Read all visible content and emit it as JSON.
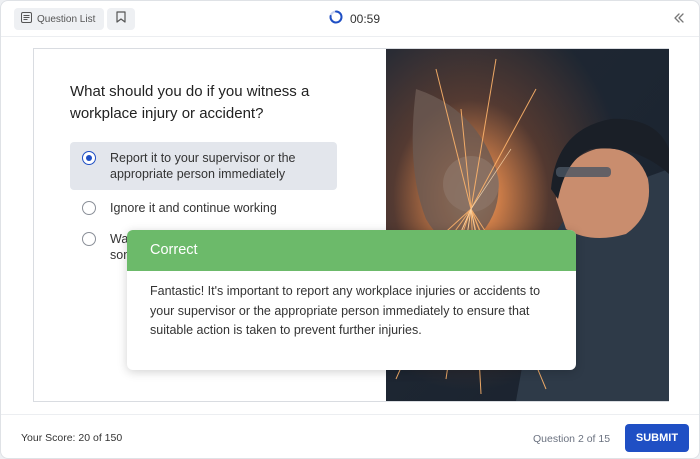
{
  "header": {
    "question_list_label": "Question List",
    "question_list_icon": "list-icon",
    "bookmark_icon": "bookmark-icon",
    "timer_icon": "timer-ring-icon",
    "timer": "00:59",
    "collapse_icon": "double-chevron-left-icon"
  },
  "question": {
    "text": "What should you do if you witness a workplace injury or accident?",
    "options": [
      {
        "label": "Report it to your supervisor or the appropriate person immediately",
        "selected": true
      },
      {
        "label": "Ignore it and continue working",
        "selected": false
      },
      {
        "label": "Wait for someone else to",
        "selected": false
      }
    ],
    "image_alt": "worker grinding metal with sparks"
  },
  "feedback": {
    "status": "Correct",
    "message": "Fantastic! It's important to report any workplace injuries or accidents to your supervisor or the appropriate person immediately to ensure that suitable action is taken to prevent further injuries."
  },
  "footer": {
    "score": "Your Score: 20 of 150",
    "progress": "Question 2 of 15",
    "submit_label": "SUBMIT"
  },
  "colors": {
    "accent": "#1f4fc4",
    "correct": "#6cba6a",
    "selected_bg": "#e3e6ec"
  }
}
